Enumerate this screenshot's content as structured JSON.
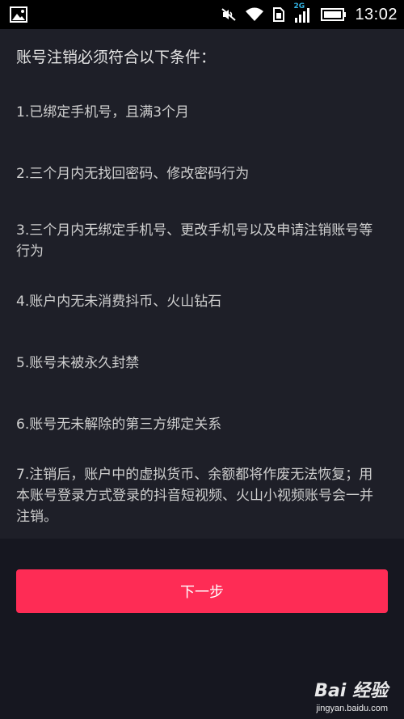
{
  "status_bar": {
    "time": "13:02",
    "network_label": "2G",
    "icons": [
      "image-notification-icon",
      "mute-icon",
      "wifi-icon",
      "sim-icon",
      "signal-icon",
      "battery-icon"
    ]
  },
  "content": {
    "heading": "账号注销必须符合以下条件：",
    "conditions": [
      "1.已绑定手机号，且满3个月",
      "2.三个月内无找回密码、修改密码行为",
      "3.三个月内无绑定手机号、更改手机号以及申请注销账号等行为",
      "4.账户内无未消费抖币、火山钻石",
      "5.账号未被永久封禁",
      "6.账号无未解除的第三方绑定关系",
      "7.注销后，账户中的虚拟货币、余额都将作废无法恢复；用本账号登录方式登录的抖音短视频、火山小视频账号会一并注销。"
    ]
  },
  "actions": {
    "next_label": "下一步"
  },
  "watermark": {
    "logo_text": "Bai  经验",
    "url": "jingyan.baidu.com"
  },
  "colors": {
    "background": "#000000",
    "panel": "#1e1f28",
    "lower_area": "#161720",
    "accent": "#fe2c55",
    "text": "#cfcfcf"
  }
}
